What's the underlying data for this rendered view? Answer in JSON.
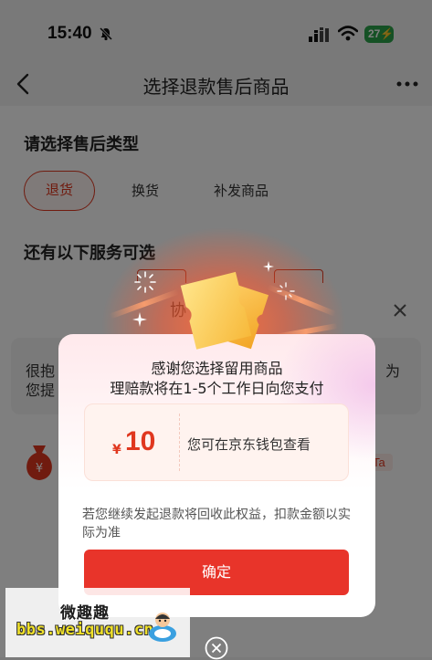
{
  "status_bar": {
    "time": "15:40",
    "battery": "27"
  },
  "nav": {
    "title": "选择退款售后商品"
  },
  "aftersale": {
    "type_heading": "请选择售后类型",
    "options": [
      {
        "label": "退货",
        "selected": true
      },
      {
        "label": "换货",
        "selected": false
      },
      {
        "label": "补发商品",
        "selected": false
      }
    ],
    "services_heading": "还有以下服务可选"
  },
  "sheet": {
    "title_fragment": "协",
    "text_left_1": "很抱",
    "text_left_2": "您提",
    "text_right": "为",
    "tag": "Ta"
  },
  "modal": {
    "line1": "感谢您选择留用商品",
    "line2": "理赔款将在1-5个工作日向您支付",
    "currency": "¥",
    "amount": "10",
    "amount_note": "您可在京东钱包查看",
    "notice": "若您继续发起退款将回收此权益，扣款金额以实际为准",
    "confirm_label": "确定"
  },
  "watermark": {
    "title": "微趣趣",
    "url": "bbs.weiququ.cn"
  },
  "colors": {
    "accent": "#e8342a",
    "overlay": "rgba(0,0,0,0.5)",
    "battery": "#2aa34a"
  },
  "icons": [
    "bell-off-icon",
    "signal-icon",
    "wifi-icon",
    "back-icon",
    "more-icon",
    "close-icon",
    "money-bag-icon",
    "ticket-icon",
    "sparkle-icon"
  ]
}
